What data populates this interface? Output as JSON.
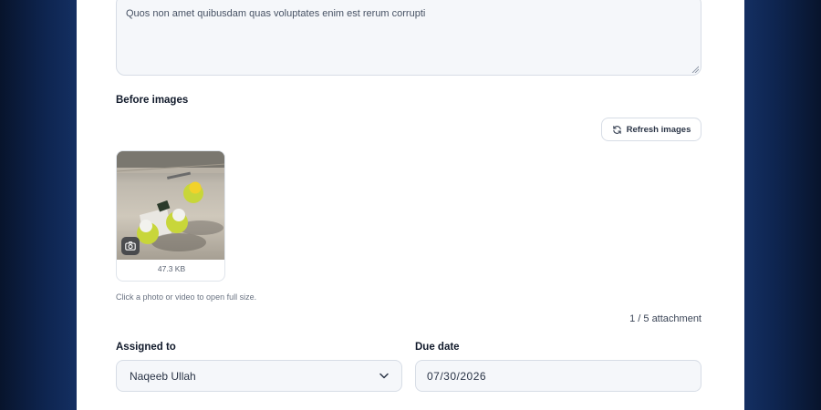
{
  "description_field": {
    "value": "Quos non amet quibusdam quas voluptates enim est rerum corrupti"
  },
  "before_images": {
    "label": "Before images",
    "refresh_label": "Refresh images",
    "refresh_icon": "refresh-icon",
    "thumbnail": {
      "size": "47.3 KB",
      "badge_icon": "camera-icon"
    },
    "hint": "Click a photo or video to open full size.",
    "count": "1 / 5 attachment"
  },
  "assigned_to": {
    "label": "Assigned to",
    "value": "Naqeeb Ullah"
  },
  "due_date": {
    "label": "Due date",
    "value": "07/30/2026"
  },
  "colors": {
    "background": "#0b1a36",
    "panel": "#ffffff",
    "field_bg": "#f5f7fa",
    "border": "#d7dde6"
  }
}
